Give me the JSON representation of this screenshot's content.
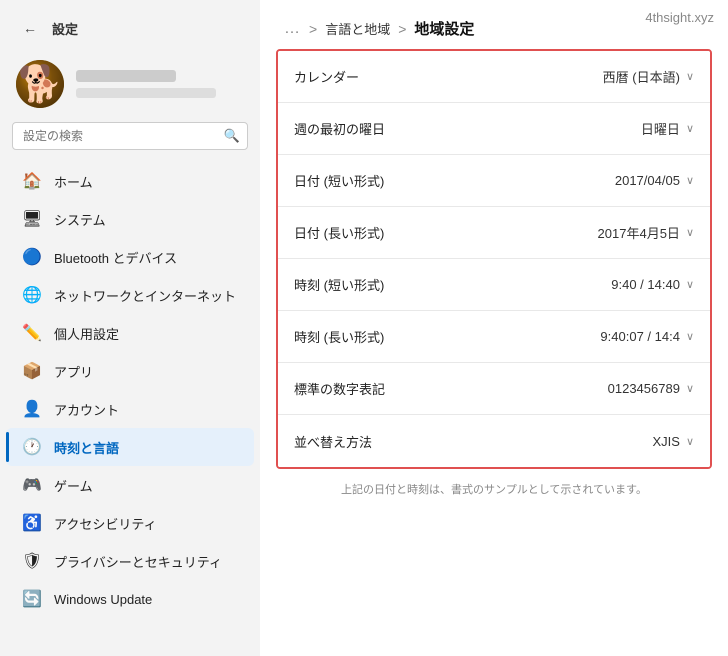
{
  "sidebar": {
    "back_label": "←",
    "title": "設定",
    "search_placeholder": "設定の検索",
    "search_icon": "🔍",
    "nav_items": [
      {
        "id": "home",
        "icon": "🏠",
        "label": "ホーム",
        "active": false
      },
      {
        "id": "system",
        "icon": "🖥",
        "label": "システム",
        "active": false
      },
      {
        "id": "bluetooth",
        "icon": "🔵",
        "label": "Bluetooth とデバイス",
        "active": false
      },
      {
        "id": "network",
        "icon": "🌐",
        "label": "ネットワークとインターネット",
        "active": false
      },
      {
        "id": "personalization",
        "icon": "✏️",
        "label": "個人用設定",
        "active": false
      },
      {
        "id": "apps",
        "icon": "📦",
        "label": "アプリ",
        "active": false
      },
      {
        "id": "accounts",
        "icon": "👤",
        "label": "アカウント",
        "active": false
      },
      {
        "id": "time",
        "icon": "🕐",
        "label": "時刻と言語",
        "active": true
      },
      {
        "id": "gaming",
        "icon": "🎮",
        "label": "ゲーム",
        "active": false
      },
      {
        "id": "accessibility",
        "icon": "♿",
        "label": "アクセシビリティ",
        "active": false
      },
      {
        "id": "privacy",
        "icon": "🛡",
        "label": "プライバシーとセキュリティ",
        "active": false
      },
      {
        "id": "windows-update",
        "icon": "🔄",
        "label": "Windows Update",
        "active": false
      }
    ]
  },
  "main": {
    "watermark": "4thsight.xyz",
    "breadcrumb_dots": "…",
    "breadcrumb_sep1": ">",
    "breadcrumb_link": "言語と地域",
    "breadcrumb_sep2": ">",
    "breadcrumb_current": "地域設定",
    "settings_rows": [
      {
        "label": "カレンダー",
        "value": "西暦 (日本語)"
      },
      {
        "label": "週の最初の曜日",
        "value": "日曜日"
      },
      {
        "label": "日付 (短い形式)",
        "value": "2017/04/05"
      },
      {
        "label": "日付 (長い形式)",
        "value": "2017年4月5日"
      },
      {
        "label": "時刻 (短い形式)",
        "value": "9:40 / 14:40"
      },
      {
        "label": "時刻 (長い形式)",
        "value": "9:40:07 / 14:4"
      },
      {
        "label": "標準の数字表記",
        "value": "0123456789"
      },
      {
        "label": "並べ替え方法",
        "value": "XJIS"
      }
    ],
    "footer_note": "上記の日付と時刻は、書式のサンプルとして示されています。"
  }
}
